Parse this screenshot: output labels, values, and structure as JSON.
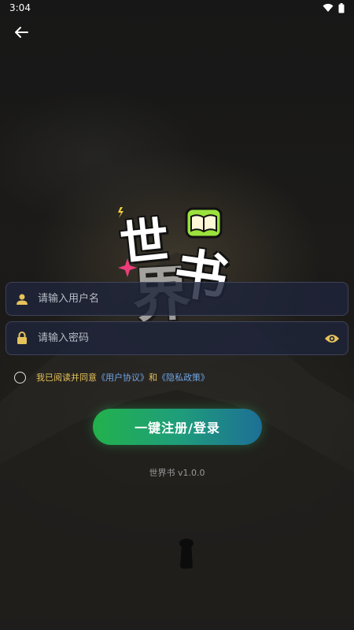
{
  "status_bar": {
    "time": "3:04"
  },
  "logo": {
    "char1": "世",
    "char2": "界",
    "char3": "书"
  },
  "username": {
    "placeholder": "请输入用户名"
  },
  "password": {
    "placeholder": "请输入密码"
  },
  "agreement": {
    "prefix": "我已阅读并同意",
    "user_agreement": "《用户协议》",
    "and": "和",
    "privacy_policy": "《隐私政策》"
  },
  "login_button": {
    "label": "一键注册/登录"
  },
  "version": "世界书 v1.0.0",
  "colors": {
    "accent_start": "#22b14c",
    "accent_end": "#1d6f96",
    "link": "#6fa6e8",
    "agreement_text": "#e6c35a"
  }
}
